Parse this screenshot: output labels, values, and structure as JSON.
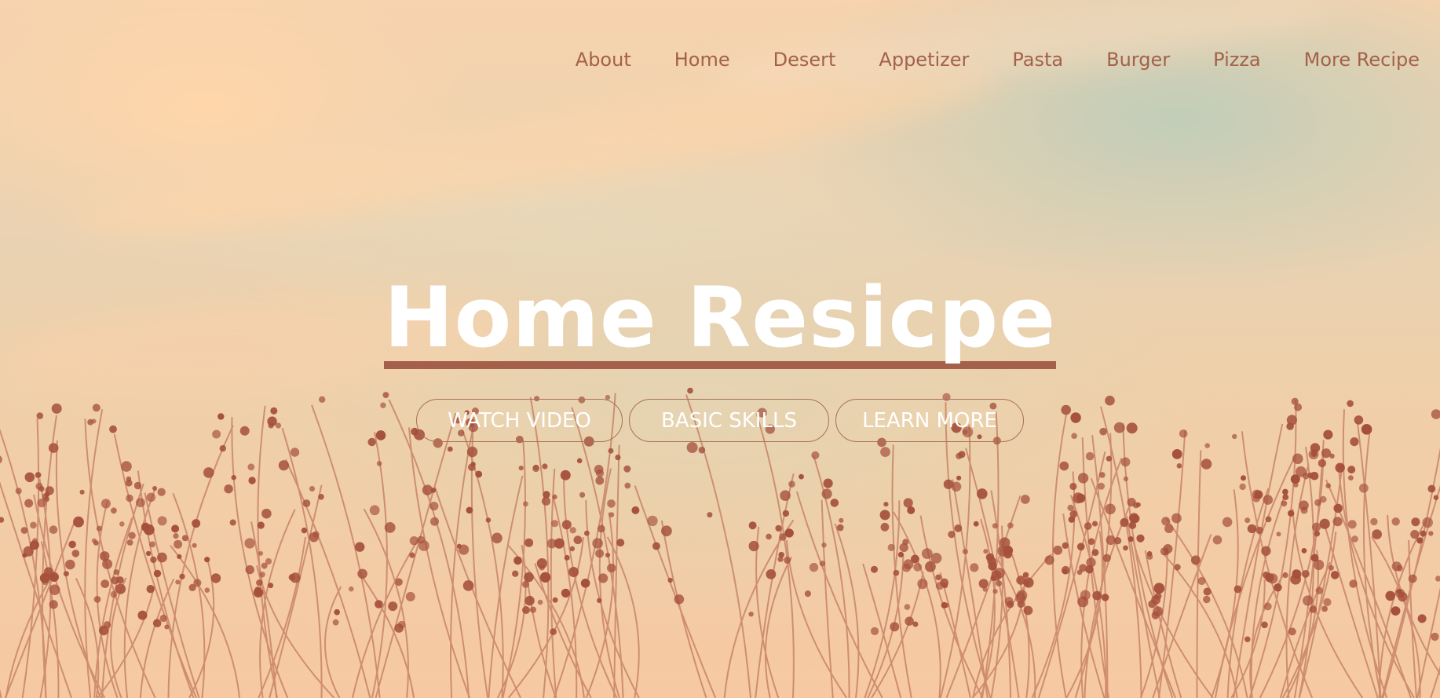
{
  "nav": {
    "items": [
      {
        "label": "About"
      },
      {
        "label": "Home"
      },
      {
        "label": "Desert"
      },
      {
        "label": "Appetizer"
      },
      {
        "label": "Pasta"
      },
      {
        "label": "Burger"
      },
      {
        "label": "Pizza"
      },
      {
        "label": "More Recipe"
      }
    ]
  },
  "hero": {
    "title": "Home Resicpe",
    "buttons": {
      "watch_video": "WATCH VIDEO",
      "basic_skills": "BASIC SKILLS",
      "learn_more": "LEARN MORE"
    }
  },
  "colors": {
    "accent": "#a4604a",
    "nav_text": "#a3614a",
    "hero_text": "#ffffff",
    "sky_warm": "#f7d3ae",
    "sky_cool": "#bfcdb9"
  },
  "icons": {
    "background": "wildflower-silhouette-image"
  }
}
